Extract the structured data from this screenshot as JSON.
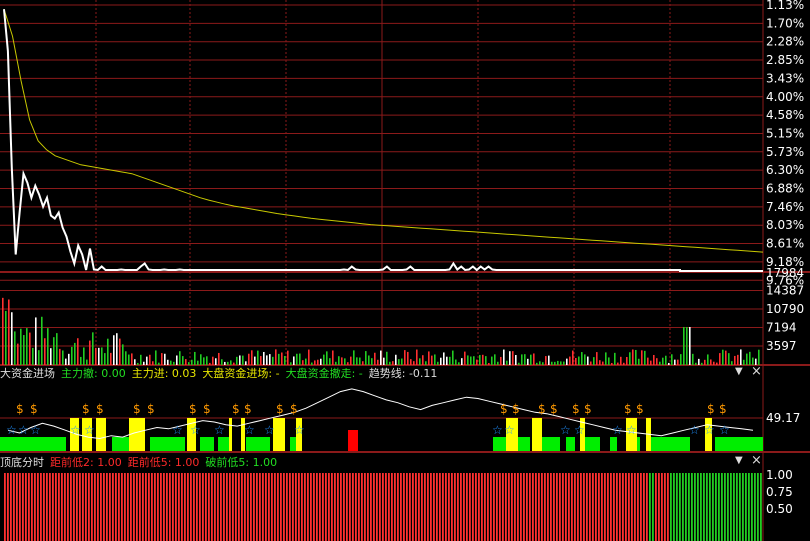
{
  "colors": {
    "background": "#000000",
    "grid": "#8b1a1a",
    "axis_text": "#ffffff",
    "price_line": "#ffffff",
    "avg_line": "#c8c800",
    "vol_up": "#ff3030",
    "vol_down": "#22cc22",
    "vol_flat": "#ffffff",
    "header_white": "#dddddd",
    "header_yellow": "#e6e600",
    "header_green": "#22dd22",
    "header_red": "#ff2a2a",
    "fund_green": "#00ee00",
    "fund_yellow": "#ffff00",
    "fund_red": "#ff0000",
    "dollar": "#ff9900",
    "star": "#1e90ff"
  },
  "chart_data": [
    {
      "type": "line",
      "panel": "price",
      "y_tick_labels": [
        "1.13%",
        "1.70%",
        "2.28%",
        "2.85%",
        "3.43%",
        "4.00%",
        "4.58%",
        "5.15%",
        "5.73%",
        "6.30%",
        "6.88%",
        "7.46%",
        "8.03%",
        "8.61%",
        "9.18%",
        "9.76%"
      ],
      "ylim": [
        0.56,
        9.76
      ],
      "y_inverted": true,
      "x_points": 240,
      "series": [
        {
          "role": "price",
          "values": [
            0.7,
            2.1,
            6.0,
            8.9,
            7.5,
            6.2,
            6.5,
            7.0,
            6.6,
            6.9,
            7.3,
            7.0,
            7.6,
            7.7,
            7.5,
            8.0,
            8.3,
            8.8,
            9.2,
            8.6,
            8.9,
            9.8,
            8.7,
            9.4,
            9.5,
            9.3,
            9.6,
            9.5,
            9.7,
            9.5,
            9.4,
            9.6,
            9.5,
            9.7,
            9.6,
            9.3,
            9.2,
            9.4,
            9.5,
            9.6,
            9.5,
            9.4,
            9.6,
            9.7,
            9.5,
            9.4,
            9.6,
            9.5,
            9.7,
            9.9,
            9.8,
            10.0,
            9.9,
            9.8,
            10.0,
            9.9,
            9.8,
            10.0,
            9.9,
            9.8,
            10.0,
            9.9,
            10.0,
            9.8,
            9.7,
            9.5,
            9.7,
            9.8,
            10.0,
            9.9,
            9.8,
            10.0,
            9.9,
            9.8,
            10.0,
            9.7,
            9.6,
            9.8,
            9.7,
            9.9,
            9.7,
            9.8,
            10.0,
            9.9,
            9.6,
            9.5,
            9.6,
            9.4,
            9.5,
            9.3,
            9.4,
            9.6,
            9.5,
            9.6,
            9.8,
            9.7,
            9.6,
            9.4,
            9.3,
            9.5,
            9.6,
            9.8,
            9.6,
            9.4,
            9.3,
            9.5,
            9.6,
            9.7,
            9.6,
            9.5,
            9.7,
            9.6,
            9.5,
            9.6,
            9.4,
            9.2,
            9.4,
            9.3,
            9.5,
            9.4,
            9.3,
            9.5,
            9.3,
            9.4,
            9.3,
            9.4,
            9.6,
            9.7,
            9.6,
            9.7,
            9.8,
            9.7,
            9.6,
            9.7,
            9.8,
            9.9,
            9.8,
            9.9,
            9.8,
            9.9,
            10.0,
            9.9,
            10.0,
            9.9,
            10.0,
            9.9,
            10.0,
            9.9,
            10.0,
            9.9,
            10.0,
            10.1,
            10.0,
            10.1,
            10.0,
            10.1,
            10.0,
            10.1,
            10.0,
            10.1,
            10.0,
            10.1,
            10.0,
            10.1,
            10.2,
            10.1,
            10.2,
            10.1,
            10.2,
            10.1,
            10.2,
            10.3,
            10.2,
            10.3
          ]
        },
        {
          "role": "average",
          "values": [
            0.7,
            1.6,
            3.1,
            4.4,
            5.1,
            5.4,
            5.6,
            5.7,
            5.8,
            5.9,
            5.95,
            6.0,
            6.05,
            6.1,
            6.15,
            6.2,
            6.3,
            6.4,
            6.5,
            6.6,
            6.7,
            6.8,
            6.9,
            7.0,
            7.08,
            7.15,
            7.22,
            7.28,
            7.33,
            7.38,
            7.43,
            7.48,
            7.53,
            7.57,
            7.61,
            7.65,
            7.69,
            7.72,
            7.75,
            7.78,
            7.81,
            7.84,
            7.87,
            7.9,
            7.92,
            7.94,
            7.96,
            7.98,
            8.0,
            8.02,
            8.04,
            8.06,
            8.08,
            8.1,
            8.12,
            8.14,
            8.16,
            8.18,
            8.2,
            8.22,
            8.24,
            8.26,
            8.28,
            8.3,
            8.32,
            8.34,
            8.36,
            8.38,
            8.4,
            8.42,
            8.44,
            8.46,
            8.48,
            8.5,
            8.52,
            8.54,
            8.56,
            8.58,
            8.6,
            8.62,
            8.64,
            8.66,
            8.68,
            8.7,
            8.72,
            8.74,
            8.76,
            8.78,
            8.8,
            8.82
          ]
        }
      ]
    },
    {
      "type": "bar",
      "panel": "volume",
      "y_tick_labels": [
        "17984",
        "14387",
        "10790",
        "7194",
        "3597"
      ],
      "ylim": [
        0,
        17984
      ]
    },
    {
      "type": "line",
      "panel": "fund_flow",
      "title": "大资金进场",
      "y_tick_labels": [
        "49.17"
      ],
      "line_values": [
        40,
        38,
        42,
        45,
        43,
        40,
        37,
        35,
        34,
        36,
        35,
        38,
        40,
        42,
        41,
        43,
        45,
        47,
        46,
        44,
        43,
        45,
        47,
        49,
        51,
        53,
        56,
        60,
        64,
        68,
        70,
        68,
        65,
        62,
        60,
        57,
        55,
        58,
        60,
        62,
        64,
        63,
        61,
        59,
        57,
        55,
        53,
        52,
        50,
        48,
        46,
        44,
        42,
        40,
        39,
        38,
        37,
        36,
        38,
        40,
        42,
        44,
        43,
        42,
        41,
        40
      ],
      "dollar_label": "$",
      "star_label": "☆"
    },
    {
      "type": "bar",
      "panel": "bottom",
      "title": "顶底分时",
      "y_tick_labels": [
        "1.00",
        "0.75",
        "0.50"
      ],
      "ylim": [
        0,
        1
      ]
    }
  ],
  "headers": {
    "fund": [
      {
        "text": "大资金进场",
        "color": "white"
      },
      {
        "text": "主力撤: 0.00",
        "color": "green"
      },
      {
        "text": "主力进: 0.03",
        "color": "yellow"
      },
      {
        "text": "大盘资金进场: -",
        "color": "yellow"
      },
      {
        "text": "大盘资金撤走: -",
        "color": "green"
      },
      {
        "text": "趋势线: -0.11",
        "color": "white"
      }
    ],
    "bottom": [
      {
        "text": "顶底分时",
        "color": "white"
      },
      {
        "text": "距前低2: 1.00",
        "color": "red"
      },
      {
        "text": "距前低5: 1.00",
        "color": "red"
      },
      {
        "text": "破前低5: 1.00",
        "color": "green"
      }
    ]
  },
  "controls": {
    "dropdown_icon": "▼",
    "close_icon": "×"
  }
}
